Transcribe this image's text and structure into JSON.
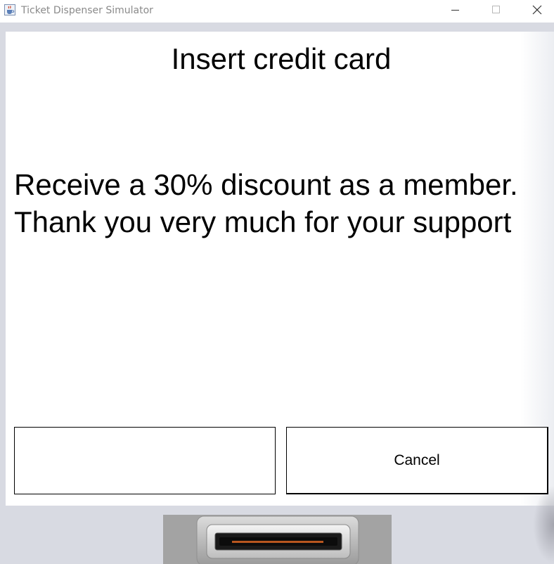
{
  "window": {
    "title": "Ticket Dispenser Simulator",
    "icon": "java-cup-icon",
    "controls": [
      "minimize-icon",
      "maximize-icon",
      "close-icon"
    ]
  },
  "screen": {
    "heading": "Insert credit card",
    "message": "Receive a 30% discount as a member. Thank you very much for your support"
  },
  "buttons": {
    "left_label": "",
    "cancel_label": "Cancel"
  },
  "card_reader": {
    "icon": "card-slot-icon"
  },
  "colors": {
    "background": "#d8dae2",
    "panel": "#ffffff",
    "slot_housing": "#a3a3a3",
    "slot_stripe": "#b8561f"
  }
}
